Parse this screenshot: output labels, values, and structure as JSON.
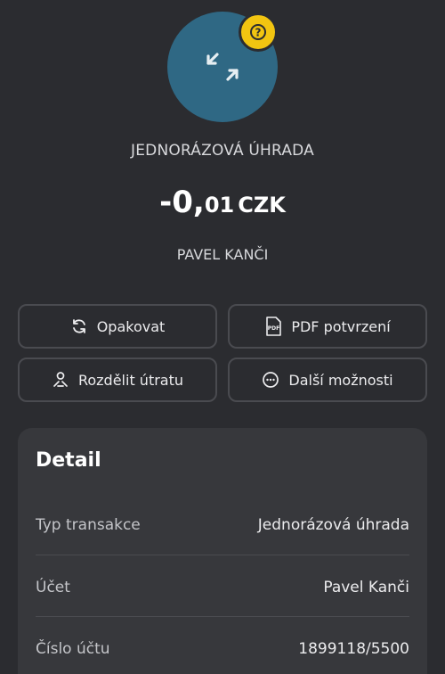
{
  "header": {
    "transaction_type": "JEDNORÁZOVÁ ÚHRADA",
    "amount_int": "-0,",
    "amount_dec": "01",
    "currency": "CZK",
    "counterparty": "PAVEL KANČI"
  },
  "icons": {
    "avatar": "transfer-arrows-icon",
    "badge": "help-icon"
  },
  "colors": {
    "background": "#2b2c30",
    "avatar": "#2f6884",
    "badge": "#f2c511",
    "card": "#37383c"
  },
  "actions": {
    "repeat": "Opakovat",
    "pdf": "PDF potvrzení",
    "split": "Rozdělit útratu",
    "more": "Další možnosti"
  },
  "detail": {
    "title": "Detail",
    "rows": [
      {
        "label": "Typ transakce",
        "value": "Jednorázová úhrada"
      },
      {
        "label": "Účet",
        "value": "Pavel Kanči"
      },
      {
        "label": "Číslo účtu",
        "value": "1899118/5500"
      }
    ]
  }
}
